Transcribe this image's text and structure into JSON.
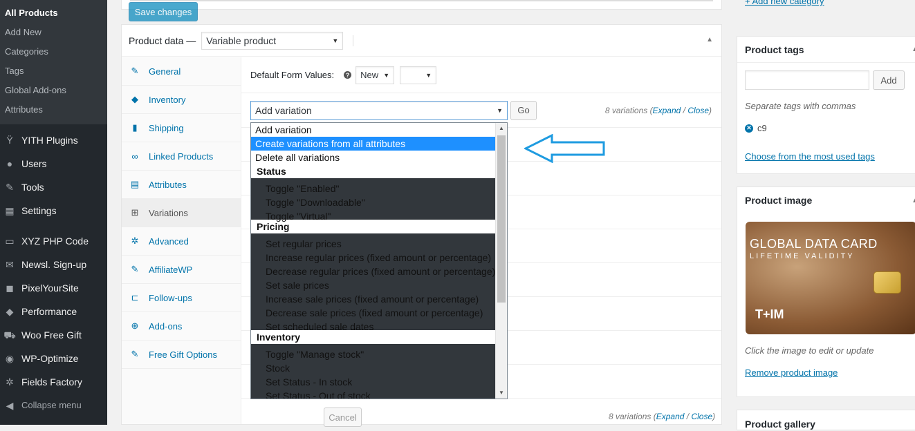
{
  "sidebar": {
    "submenu": [
      "All Products",
      "Add New",
      "Categories",
      "Tags",
      "Global Add-ons",
      "Attributes"
    ],
    "menu": [
      {
        "label": "YITH Plugins",
        "icon": "yith-icon"
      },
      {
        "label": "Users",
        "icon": "users-icon"
      },
      {
        "label": "Tools",
        "icon": "tools-icon"
      },
      {
        "label": "Settings",
        "icon": "settings-icon"
      },
      {
        "label": "XYZ PHP Code",
        "icon": "php-icon"
      },
      {
        "label": "Newsl. Sign-up",
        "icon": "mail-icon"
      },
      {
        "label": "PixelYourSite",
        "icon": "pixel-icon"
      },
      {
        "label": "Performance",
        "icon": "performance-icon"
      },
      {
        "label": "Woo Free Gift",
        "icon": "cart-icon"
      },
      {
        "label": "WP-Optimize",
        "icon": "optimize-icon"
      },
      {
        "label": "Fields Factory",
        "icon": "gear-icon"
      }
    ],
    "collapse": "Collapse menu"
  },
  "product_data": {
    "title": "Product data —",
    "type": "Variable product",
    "tabs": [
      {
        "label": "General",
        "icon": "wrench-icon"
      },
      {
        "label": "Inventory",
        "icon": "tag-icon"
      },
      {
        "label": "Shipping",
        "icon": "truck-icon"
      },
      {
        "label": "Linked Products",
        "icon": "link-icon"
      },
      {
        "label": "Attributes",
        "icon": "list-icon"
      },
      {
        "label": "Variations",
        "icon": "grid-icon"
      },
      {
        "label": "Advanced",
        "icon": "gear-icon"
      },
      {
        "label": "AffiliateWP",
        "icon": "wrench-icon"
      },
      {
        "label": "Follow-ups",
        "icon": "bracket-icon"
      },
      {
        "label": "Add-ons",
        "icon": "plus-circle-icon"
      },
      {
        "label": "Free Gift Options",
        "icon": "wrench-icon"
      }
    ],
    "default_form_values": "Default Form Values:",
    "default_select": "New",
    "help": "?",
    "variation_select": "Add variation",
    "go": "Go",
    "count_text": "8 variations",
    "expand": "Expand",
    "close": "Close",
    "save": "Save changes",
    "cancel": "Cancel"
  },
  "dropdown": {
    "options": [
      {
        "label": "Add variation",
        "kind": "opt"
      },
      {
        "label": "Create variations from all attributes",
        "kind": "hl"
      },
      {
        "label": "Delete all variations",
        "kind": "opt"
      },
      {
        "label": "Status",
        "kind": "grp"
      },
      {
        "label": "Toggle \"Enabled\"",
        "kind": "sub"
      },
      {
        "label": "Toggle \"Downloadable\"",
        "kind": "sub"
      },
      {
        "label": "Toggle \"Virtual\"",
        "kind": "sub"
      },
      {
        "label": "Pricing",
        "kind": "grp"
      },
      {
        "label": "Set regular prices",
        "kind": "sub"
      },
      {
        "label": "Increase regular prices (fixed amount or percentage)",
        "kind": "sub"
      },
      {
        "label": "Decrease regular prices (fixed amount or percentage)",
        "kind": "sub"
      },
      {
        "label": "Set sale prices",
        "kind": "sub"
      },
      {
        "label": "Increase sale prices (fixed amount or percentage)",
        "kind": "sub"
      },
      {
        "label": "Decrease sale prices (fixed amount or percentage)",
        "kind": "sub"
      },
      {
        "label": "Set scheduled sale dates",
        "kind": "sub"
      },
      {
        "label": "Inventory",
        "kind": "grp"
      },
      {
        "label": "Toggle \"Manage stock\"",
        "kind": "sub"
      },
      {
        "label": "Stock",
        "kind": "sub"
      },
      {
        "label": "Set Status - In stock",
        "kind": "sub"
      },
      {
        "label": "Set Status - Out of stock",
        "kind": "sub"
      }
    ]
  },
  "right": {
    "add_category": "+ Add new category",
    "tags_title": "Product tags",
    "add_btn": "Add",
    "tags_hint": "Separate tags with commas",
    "tag": "c9",
    "choose_tags": "Choose from the most used tags",
    "image_title": "Product image",
    "card_title": "GLOBAL DATA CARD",
    "card_sub": "LIFETIME VALIDITY",
    "card_logo": "T+IM",
    "image_hint": "Click the image to edit or update",
    "remove_image": "Remove product image",
    "gallery_title": "Product gallery"
  },
  "colors": {
    "arrow": "#1e9be0",
    "accent": "#0073aa",
    "sidebar": "#23282d"
  }
}
